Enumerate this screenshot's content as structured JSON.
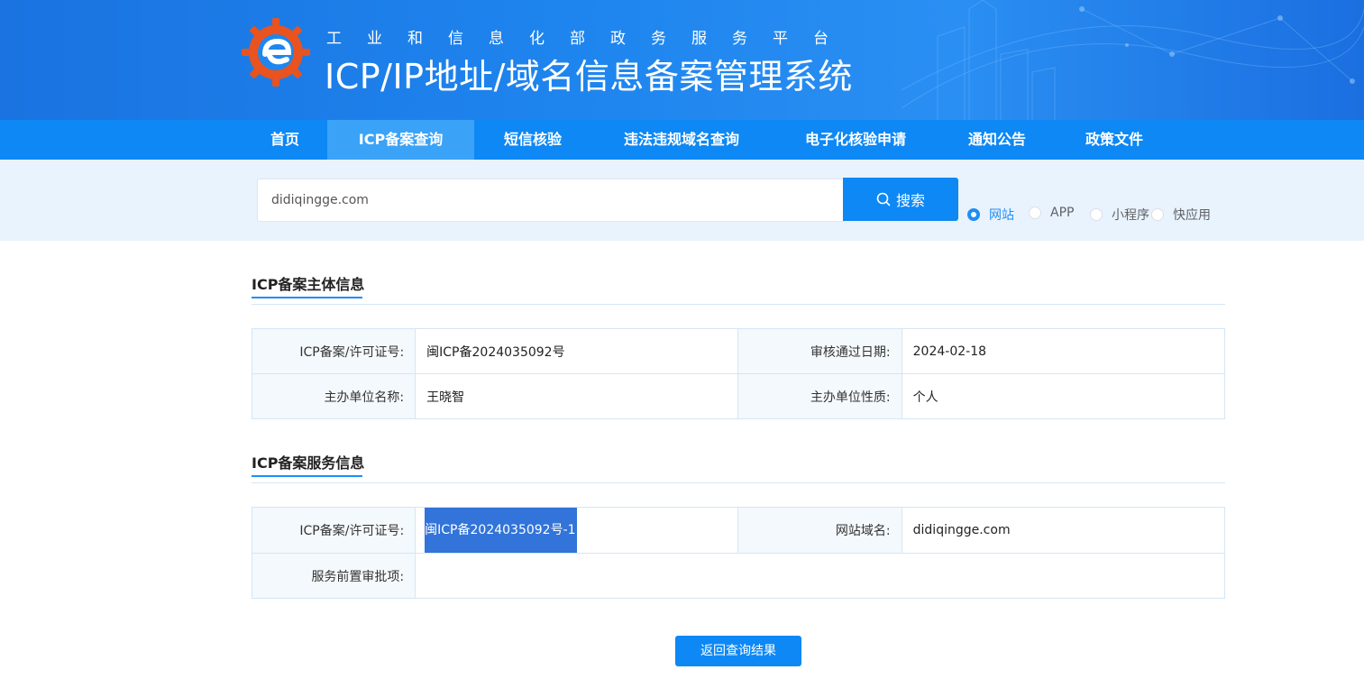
{
  "header": {
    "subtitle": "工业和信息化部政务服务平台",
    "title": "ICP/IP地址/域名信息备案管理系统"
  },
  "nav": {
    "items": [
      {
        "label": "首页",
        "active": false
      },
      {
        "label": "ICP备案查询",
        "active": true
      },
      {
        "label": "短信核验",
        "active": false
      },
      {
        "label": "违法违规域名查询",
        "active": false
      },
      {
        "label": "电子化核验申请",
        "active": false
      },
      {
        "label": "通知公告",
        "active": false
      },
      {
        "label": "政策文件",
        "active": false
      }
    ]
  },
  "search": {
    "value": "didiqingge.com",
    "button_label": "搜索",
    "types": [
      {
        "label": "网站",
        "checked": true
      },
      {
        "label": "APP",
        "checked": false
      },
      {
        "label": "小程序",
        "checked": false
      },
      {
        "label": "快应用",
        "checked": false
      }
    ]
  },
  "subject_info": {
    "title": "ICP备案主体信息",
    "license_label": "ICP备案/许可证号:",
    "license_value": "闽ICP备2024035092号",
    "approve_date_label": "审核通过日期:",
    "approve_date_value": "2024-02-18",
    "org_name_label": "主办单位名称:",
    "org_name_value": "王晓智",
    "org_type_label": "主办单位性质:",
    "org_type_value": "个人"
  },
  "service_info": {
    "title": "ICP备案服务信息",
    "license_label": "ICP备案/许可证号:",
    "license_value": "闽ICP备2024035092号-1",
    "domain_label": "网站域名:",
    "domain_value": "didiqingge.com",
    "pre_approval_label": "服务前置审批项:",
    "pre_approval_value": ""
  },
  "back_button_label": "返回查询结果",
  "colors": {
    "brand_blue": "#0d88f5",
    "nav_active": "#3aa3f7",
    "accent": "#1e8ef6",
    "selection": "#3274d9"
  }
}
